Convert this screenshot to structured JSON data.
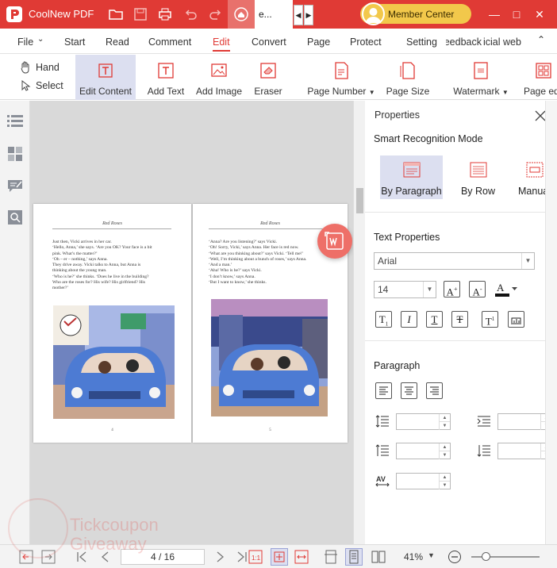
{
  "app": {
    "name": "CoolNew PDF",
    "doc_tab": "e...",
    "member": "Member Center"
  },
  "menu": [
    "File",
    "Start",
    "Read",
    "Comment",
    "Edit",
    "Convert",
    "Page",
    "Protect",
    "Setting",
    "Feedback",
    "icial web"
  ],
  "toolbar": {
    "hand": "Hand",
    "select": "Select",
    "tools": [
      "Edit Content",
      "Add Text",
      "Add Image",
      "Eraser",
      "Page Number",
      "Page Size",
      "Watermark",
      "Page ed"
    ]
  },
  "properties": {
    "title": "Properties",
    "smart_mode": "Smart Recognition Mode",
    "modes": [
      "By Paragraph",
      "By Row",
      "Manual"
    ],
    "text_props": "Text Properties",
    "font": "Arial",
    "size": "14",
    "paragraph": "Paragraph"
  },
  "document": {
    "header_left": "Red Roses",
    "header_right": "Red Roses",
    "text_left": [
      "Just then, Vicki arrives in her car.",
      "   ‘Hello, Anna,’ she says. ‘Are you OK? Your face is a bit",
      "pink. What’s the matter?’",
      "   ‘Oh – er – nothing,’ says Anna.",
      "   They drive away. Vicki talks to Anna, but Anna is",
      "thinking about the young man.",
      "   ‘Who is he?’ she thinks. ‘Does he live in the building?",
      "Who are the roses for? His wife? His girlfriend? His",
      "mother?’"
    ],
    "text_right": [
      "‘Anna? Are you listening?’ says Vicki.",
      "   ‘Oh! Sorry, Vicki,’ says Anna. Her face is red now.",
      "   ‘What are you thinking about?’ says Vicki. ‘Tell me!’",
      "   ‘Well, I’m thinking about a bunch of roses,’ says Anna.",
      "‘And a man.’",
      "   ‘Aha! Who is he?’ says Vicki.",
      "   ‘I don’t know,’ says Anna.",
      "   ‘But I want to know,’ she thinks."
    ],
    "page_num_left": "4",
    "page_num_right": "5"
  },
  "status": {
    "page": "4 / 16",
    "zoom": "41%"
  },
  "watermark": [
    "Tickcoupon",
    "Giveaway"
  ],
  "colors": {
    "brand": "#e03a35",
    "selected": "#dcdff0",
    "member": "#f2c84b"
  }
}
